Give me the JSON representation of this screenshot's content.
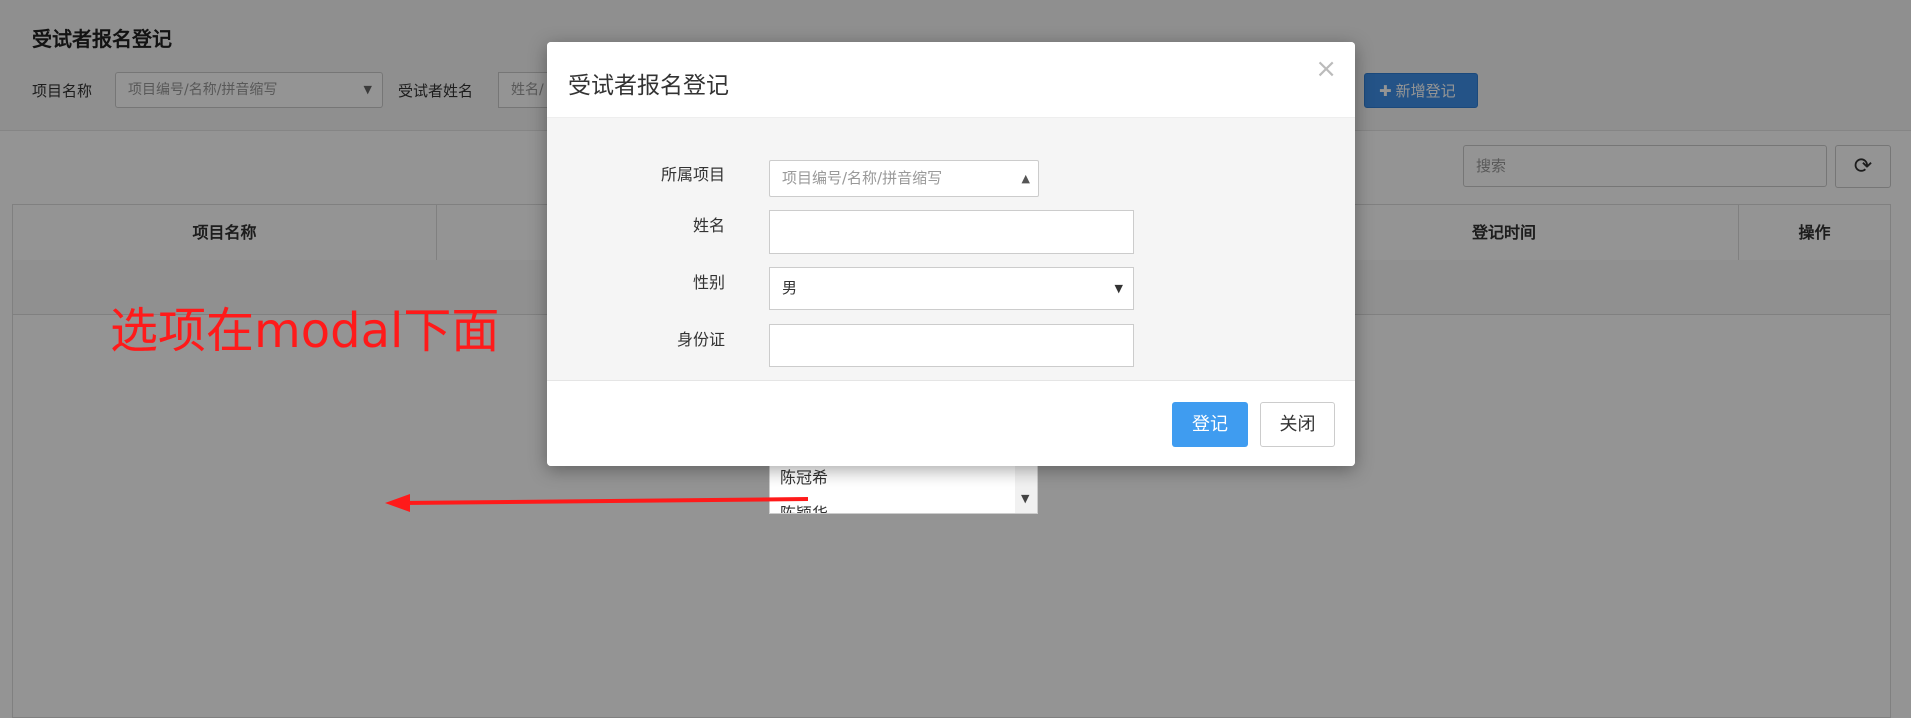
{
  "page": {
    "title": "受试者报名登记",
    "filters": {
      "project_label": "项目名称",
      "project_placeholder": "项目编号/名称/拼音缩写",
      "subject_label": "受试者姓名",
      "subject_placeholder": "姓名/"
    },
    "add_button": "新增登记",
    "search_placeholder": "搜索",
    "table": {
      "columns": [
        "项目名称",
        "登记时间",
        "操作"
      ]
    }
  },
  "dropdown": {
    "visible_options": [
      "陈冠希",
      "陈颖华"
    ]
  },
  "annotation": {
    "text": "选项在modal下面",
    "color": "#ff1a1a"
  },
  "modal": {
    "title": "受试者报名登记",
    "close_glyph": "×",
    "fields": {
      "project_label": "所属项目",
      "project_placeholder": "项目编号/名称/拼音缩写",
      "name_label": "姓名",
      "gender_label": "性别",
      "gender_value": "男",
      "id_label": "身份证"
    },
    "submit_label": "登记",
    "close_label": "关闭"
  },
  "colors": {
    "primary": "#3f9cf0",
    "backdrop": "#000000",
    "annotation": "#ff1a1a"
  }
}
